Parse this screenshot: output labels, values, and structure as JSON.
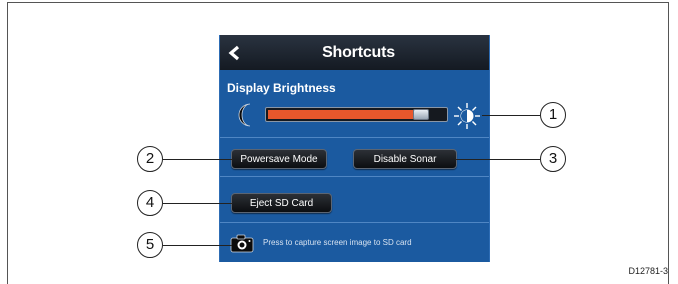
{
  "header": {
    "title": "Shortcuts",
    "back_icon": "chevron-left-icon"
  },
  "brightness": {
    "label": "Display Brightness",
    "level": 0.9,
    "low_icon": "moon-icon",
    "high_icon": "sun-icon"
  },
  "buttons": {
    "powersave": "Powersave Mode",
    "disable_sonar": "Disable Sonar",
    "eject_sd": "Eject SD Card"
  },
  "capture": {
    "icon": "camera-icon",
    "text": "Press to capture screen image to SD card"
  },
  "callouts": [
    "1",
    "2",
    "3",
    "4",
    "5"
  ],
  "doc_id": "D12781-3",
  "colors": {
    "panel_bg": "#1b5aa0",
    "slider_fill": "#e8572c",
    "title_bar": "#141a22"
  }
}
